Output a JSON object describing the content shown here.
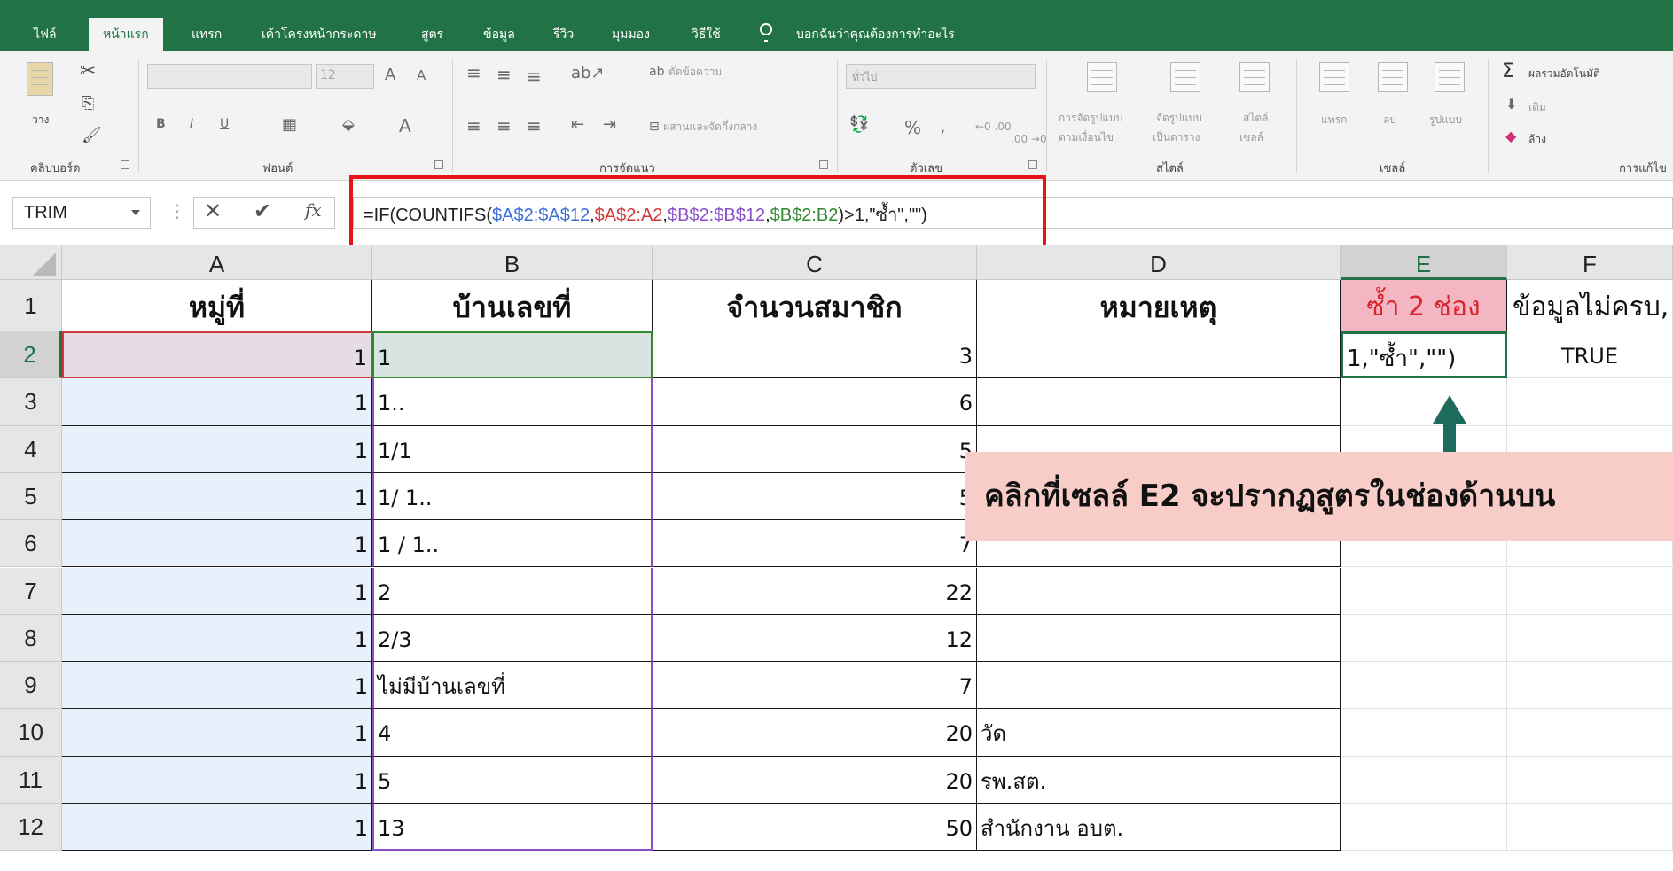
{
  "ribbon_tabs": [
    "ไฟล์",
    "หน้าแรก",
    "แทรก",
    "เค้าโครงหน้ากระดาษ",
    "สูตร",
    "ข้อมูล",
    "รีวิว",
    "มุมมอง",
    "วิธีใช้"
  ],
  "tell_me": "บอกฉันว่าคุณต้องการทำอะไร",
  "ribbon": {
    "clipboard": {
      "paste": "วาง",
      "label": "คลิปบอร์ด"
    },
    "font": {
      "size": "12",
      "grow": "A",
      "shrink": "A",
      "bold": "B",
      "italic": "I",
      "underline": "U",
      "font_color": "A",
      "label": "ฟอนต์"
    },
    "alignment": {
      "wrap": "ตัดข้อความ",
      "merge": "ผสานและจัดกึ่งกลาง",
      "label": "การจัดแนว"
    },
    "number": {
      "format": "ทั่วไป",
      "percent": "%",
      "comma": ",",
      "inc": "←0 .00",
      "dec": ".00 →0",
      "label": "ตัวเลข"
    },
    "styles": {
      "conditional": "การจัดรูปแบบ",
      "conditional2": "ตามเงื่อนไข",
      "table": "จัดรูปแบบ",
      "table2": "เป็นตาราง",
      "cell": "สไตล์",
      "cell2": "เซลล์",
      "label": "สไตล์"
    },
    "cells": {
      "insert": "แทรก",
      "delete": "ลบ",
      "format": "รูปแบบ",
      "label": "เซลล์"
    },
    "editing": {
      "autosum": "ผลรวมอัตโนมัติ",
      "fill": "เติม",
      "clear": "ล้าง",
      "label": "การแก้ไข"
    }
  },
  "formula_bar": {
    "name_box": "TRIM",
    "formula_parts": [
      {
        "t": "=IF(COUNTIFS(",
        "c": ""
      },
      {
        "t": "$A$2:$A$12",
        "c": "c-blue"
      },
      {
        "t": ",",
        "c": ""
      },
      {
        "t": "$A$2:A2",
        "c": "c-red"
      },
      {
        "t": ",",
        "c": ""
      },
      {
        "t": "$B$2:$B$12",
        "c": "c-purple"
      },
      {
        "t": ",",
        "c": ""
      },
      {
        "t": "$B$2:B2",
        "c": "c-green"
      },
      {
        "t": ")>1,\"ซ้ำ\",\"\")",
        "c": ""
      }
    ]
  },
  "columns": [
    "A",
    "B",
    "C",
    "D",
    "E",
    "F"
  ],
  "rows": [
    "1",
    "2",
    "3",
    "4",
    "5",
    "6",
    "7",
    "8",
    "9",
    "10",
    "11",
    "12"
  ],
  "headers": {
    "A": "หมู่ที่",
    "B": "บ้านเลขที่",
    "C": "จำนวนสมาชิก",
    "D": "หมายเหตุ",
    "E": "ซ้ำ 2 ช่อง",
    "F": "ข้อมูลไม่ครบ,"
  },
  "data_rows": [
    {
      "a": "1",
      "b": "1",
      "c": "3",
      "d": "",
      "e": "1,\"ซ้ำ\",\"\")",
      "f": "TRUE"
    },
    {
      "a": "1",
      "b": "1..",
      "c": "6",
      "d": "",
      "e": "",
      "f": ""
    },
    {
      "a": "1",
      "b": "1/1",
      "c": "5",
      "d": "",
      "e": "",
      "f": ""
    },
    {
      "a": "1",
      "b": "1/ 1..",
      "c": "5",
      "d": "",
      "e": "",
      "f": ""
    },
    {
      "a": "1",
      "b": "1 / 1..",
      "c": "7",
      "d": "",
      "e": "",
      "f": ""
    },
    {
      "a": "1",
      "b": "2",
      "c": "22",
      "d": "",
      "e": "",
      "f": ""
    },
    {
      "a": "1",
      "b": "2/3",
      "c": "12",
      "d": "",
      "e": "",
      "f": ""
    },
    {
      "a": "1",
      "b": "ไม่มีบ้านเลขที่",
      "c": "7",
      "d": "",
      "e": "",
      "f": ""
    },
    {
      "a": "1",
      "b": "4",
      "c": "20",
      "d": "วัด",
      "e": "",
      "f": ""
    },
    {
      "a": "1",
      "b": "5",
      "c": "20",
      "d": "รพ.สต.",
      "e": "",
      "f": ""
    },
    {
      "a": "1",
      "b": "13",
      "c": "50",
      "d": "สำนักงาน อบต.",
      "e": "",
      "f": ""
    }
  ],
  "callout": "คลิกที่เซลล์ E2 จะปรากฏสูตรในช่องด้านบน",
  "colors": {
    "excel_green": "#217346",
    "highlight_red": "#e8131b",
    "arrow": "#1e6b5e",
    "callout_bg": "#f8cdc7",
    "header_pink": "#f4b6c2",
    "range_blue": "#e8f0fb",
    "range_purple": "#8a4fc9"
  }
}
